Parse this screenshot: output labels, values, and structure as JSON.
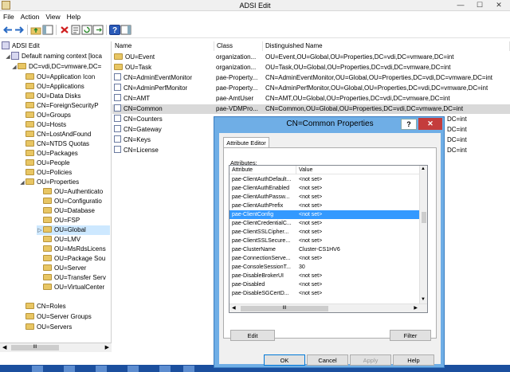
{
  "window": {
    "title": "ADSI Edit",
    "min": "—",
    "max": "☐",
    "close": "✕"
  },
  "menu": [
    "File",
    "Action",
    "View",
    "Help"
  ],
  "tree": {
    "root": "ADSI Edit",
    "context": "Default naming context [loca",
    "dc": "DC=vdi,DC=vmware,DC=",
    "items": [
      "OU=Application Icon",
      "OU=Applications",
      "OU=Data Disks",
      "CN=ForeignSecurityP",
      "OU=Groups",
      "OU=Hosts",
      "CN=LostAndFound",
      "CN=NTDS Quotas",
      "OU=Packages",
      "OU=People",
      "OU=Policies",
      "OU=Properties"
    ],
    "properties_children": [
      "OU=Authenticato",
      "OU=Configuratio",
      "OU=Database",
      "OU=FSP",
      "OU=Global",
      "OU=LMV",
      "OU=MsRdsLicens",
      "OU=Package Sou",
      "OU=Server",
      "OU=Transfer Serv",
      "OU=VirtualCenter"
    ],
    "tail": [
      "CN=Roles",
      "OU=Server Groups",
      "OU=Servers"
    ],
    "scroll_thumb": "III"
  },
  "list": {
    "columns": [
      "Name",
      "Class",
      "Distinguished Name"
    ],
    "rows": [
      {
        "name": "OU=Event",
        "class": "organization...",
        "dn": "OU=Event,OU=Global,OU=Properties,DC=vdi,DC=vmware,DC=int"
      },
      {
        "name": "OU=Task",
        "class": "organization...",
        "dn": "OU=Task,OU=Global,OU=Properties,DC=vdi,DC=vmware,DC=int"
      },
      {
        "name": "CN=AdminEventMonitor",
        "class": "pae-Property...",
        "dn": "CN=AdminEventMonitor,OU=Global,OU=Properties,DC=vdi,DC=vmware,DC=int"
      },
      {
        "name": "CN=AdminPerfMonitor",
        "class": "pae-Property...",
        "dn": "CN=AdminPerfMonitor,OU=Global,OU=Properties,DC=vdi,DC=vmware,DC=int"
      },
      {
        "name": "CN=AMT",
        "class": "pae-AmtUser",
        "dn": "CN=AMT,OU=Global,OU=Properties,DC=vdi,DC=vmware,DC=int"
      },
      {
        "name": "CN=Common",
        "class": "pae-VDMPro...",
        "dn": "CN=Common,OU=Global,OU=Properties,DC=vdi,DC=vmware,DC=int"
      },
      {
        "name": "CN=Counters",
        "class": "",
        "dn": "DC=int"
      },
      {
        "name": "CN=Gateway",
        "class": "",
        "dn": "DC=int"
      },
      {
        "name": "CN=Keys",
        "class": "",
        "dn": "DC=int"
      },
      {
        "name": "CN=License",
        "class": "",
        "dn": "DC=int"
      }
    ]
  },
  "dialog": {
    "title": "CN=Common Properties",
    "help": "?",
    "close": "✕",
    "tab": "Attribute Editor",
    "attributes_label": "Attributes:",
    "columns": [
      "Attribute",
      "Value"
    ],
    "rows": [
      {
        "attr": "pae-ClientAuthDefault...",
        "value": "<not set>"
      },
      {
        "attr": "pae-ClientAuthEnabled",
        "value": "<not set>"
      },
      {
        "attr": "pae-ClientAuthPassw...",
        "value": "<not set>"
      },
      {
        "attr": "pae-ClientAuthPrefix",
        "value": "<not set>"
      },
      {
        "attr": "pae-ClientConfig",
        "value": "<not set>"
      },
      {
        "attr": "pae-ClientCredentialC...",
        "value": "<not set>"
      },
      {
        "attr": "pae-ClientSSLCipher...",
        "value": "<not set>"
      },
      {
        "attr": "pae-ClientSSLSecure...",
        "value": "<not set>"
      },
      {
        "attr": "pae-ClusterName",
        "value": "Cluster-CS1HV6"
      },
      {
        "attr": "pae-ConnectionServe...",
        "value": "<not set>"
      },
      {
        "attr": "pae-ConsoleSessionT...",
        "value": "30"
      },
      {
        "attr": "pae-DisableBrokerUI",
        "value": "<not set>"
      },
      {
        "attr": "pae-Disabled",
        "value": "<not set>"
      },
      {
        "attr": "pae-DisableSGCertD...",
        "value": "<not set>"
      }
    ],
    "scroll_thumb": "III",
    "edit": "Edit",
    "filter": "Filter",
    "ok": "OK",
    "cancel": "Cancel",
    "apply": "Apply",
    "help_btn": "Help"
  }
}
